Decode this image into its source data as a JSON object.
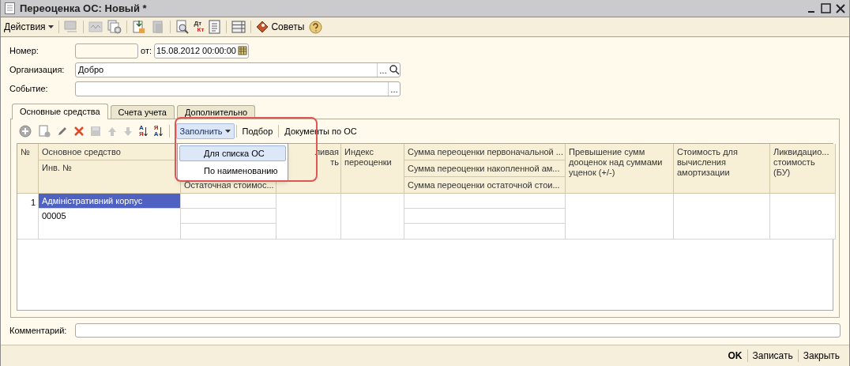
{
  "window": {
    "title": "Переоценка ОС: Новый *"
  },
  "toolbar": {
    "actions_label": "Действия",
    "dt_kt": [
      "Дт",
      "Кт"
    ],
    "tips_label": "Советы"
  },
  "form": {
    "number_label": "Номер:",
    "date_label": "от:",
    "date": "15.08.2012 00:00:00",
    "organization_label": "Организация:",
    "organization": "Добро",
    "event_label": "Событие:",
    "organization_select_button": "…",
    "event_select_button": "…"
  },
  "tabs": [
    {
      "label": "Основные средства",
      "selected": true
    },
    {
      "label": "Счета учета",
      "selected": false
    },
    {
      "label": "Дополнительно",
      "selected": false
    }
  ],
  "table_toolbar": {
    "sort_asc": [
      "А",
      "Я"
    ],
    "sort_desc": [
      "Я",
      "А"
    ],
    "buttons": [
      {
        "label": "Заполнить",
        "kind": "dropdown",
        "pressed": true
      },
      {
        "label": "Подбор",
        "kind": "plain",
        "pressed": false
      },
      {
        "label": "Документы по ОС",
        "kind": "plain",
        "pressed": false
      }
    ]
  },
  "dropdown_menu": {
    "items": [
      {
        "label": "Для списка ОС",
        "selected": true
      },
      {
        "label": "По наименованию",
        "selected": false
      }
    ]
  },
  "table": {
    "columns": [
      {
        "kind": "single",
        "lines": [
          "№"
        ]
      },
      {
        "kind": "split",
        "lines": [
          "Основное средство",
          "Инв. №"
        ]
      },
      {
        "kind": "bottom",
        "lines": [
          "Остаточная стоимос..."
        ]
      },
      {
        "kind": "covered",
        "lines": [
          "ливая",
          "ть"
        ]
      },
      {
        "kind": "single",
        "lines": [
          "Индекс",
          "переоценки"
        ]
      },
      {
        "kind": "triple",
        "lines": [
          "Сумма переоценки первоначальной ...",
          "Сумма переоценки накопленной ам...",
          "Сумма переоценки остаточной стои..."
        ]
      },
      {
        "kind": "single",
        "lines": [
          "Превышение сумм",
          "дооценок над суммами",
          "уценок (+/-)"
        ]
      },
      {
        "kind": "single",
        "lines": [
          "Стоимость для",
          "вычисления",
          "амортизации"
        ]
      },
      {
        "kind": "single",
        "lines": [
          "Ликвидацио...",
          "стоимость",
          "(БУ)"
        ]
      }
    ],
    "rows": [
      {
        "number": "1",
        "asset": "Адміністративний корпус",
        "inventory_number": "00005",
        "selected": true
      }
    ]
  },
  "comment_label": "Комментарий:",
  "footer_buttons": [
    {
      "label": "OK",
      "default": true
    },
    {
      "label": "Записать",
      "default": false
    },
    {
      "label": "Закрыть",
      "default": false
    }
  ]
}
